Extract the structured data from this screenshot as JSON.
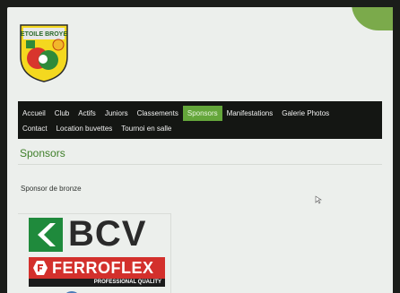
{
  "colors": {
    "nav_background": "#141613",
    "nav_active": "#64a63b",
    "title_green": "#3f7f2a",
    "page_background": "#ecefec",
    "bcv_green": "#1f8a3c",
    "ferroflex_red": "#d3302c"
  },
  "logo": {
    "text": "ETOILE BROYE",
    "icon": "club-crest-logo"
  },
  "nav": {
    "row1": [
      "Accueil",
      "Club",
      "Actifs",
      "Juniors",
      "Classements",
      "Sponsors",
      "Manifestations",
      "Galerie Photos"
    ],
    "row2": [
      "Contact",
      "Location buvettes",
      "Tournoi en salle"
    ],
    "active": "Sponsors"
  },
  "page": {
    "title": "Sponsors",
    "level": "Sponsor de bronze"
  },
  "sponsors": [
    {
      "name": "BCV",
      "icon": "bcv-arrow-logo"
    },
    {
      "name": "FERROFLEX",
      "tagline": "PROFESSIONAL QUALITY",
      "icon": "ferroflex-f-logo"
    }
  ]
}
